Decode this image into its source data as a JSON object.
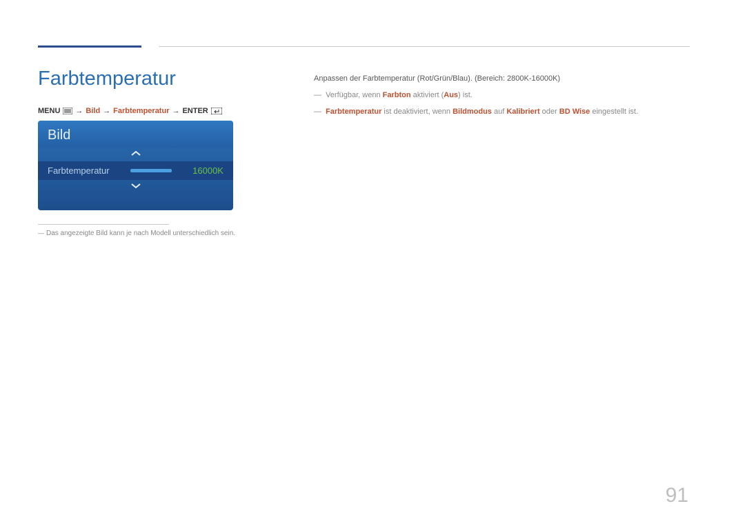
{
  "page_title": "Farbtemperatur",
  "nav": {
    "menu_label": "MENU",
    "arrow": "→",
    "bild": "Bild",
    "farbtemp": "Farbtemperatur",
    "enter": "ENTER"
  },
  "osd": {
    "header": "Bild",
    "item_label": "Farbtemperatur",
    "item_value": "16000K"
  },
  "footnote_left": "Das angezeigte Bild kann je nach Modell unterschiedlich sein.",
  "right": {
    "description": "Anpassen der Farbtemperatur (Rot/Grün/Blau). (Bereich: 2800K-16000K)",
    "note1_pre": "Verfügbar, wenn ",
    "note1_em1": "Farbton",
    "note1_mid": " aktiviert (",
    "note1_em2": "Aus",
    "note1_post": ") ist.",
    "note2_em1": "Farbtemperatur",
    "note2_mid1": " ist deaktiviert, wenn ",
    "note2_em2": "Bildmodus",
    "note2_mid2": " auf ",
    "note2_em3": "Kalibriert",
    "note2_mid3": " oder ",
    "note2_em4": "BD Wise",
    "note2_post": " eingestellt ist."
  },
  "page_number": "91"
}
